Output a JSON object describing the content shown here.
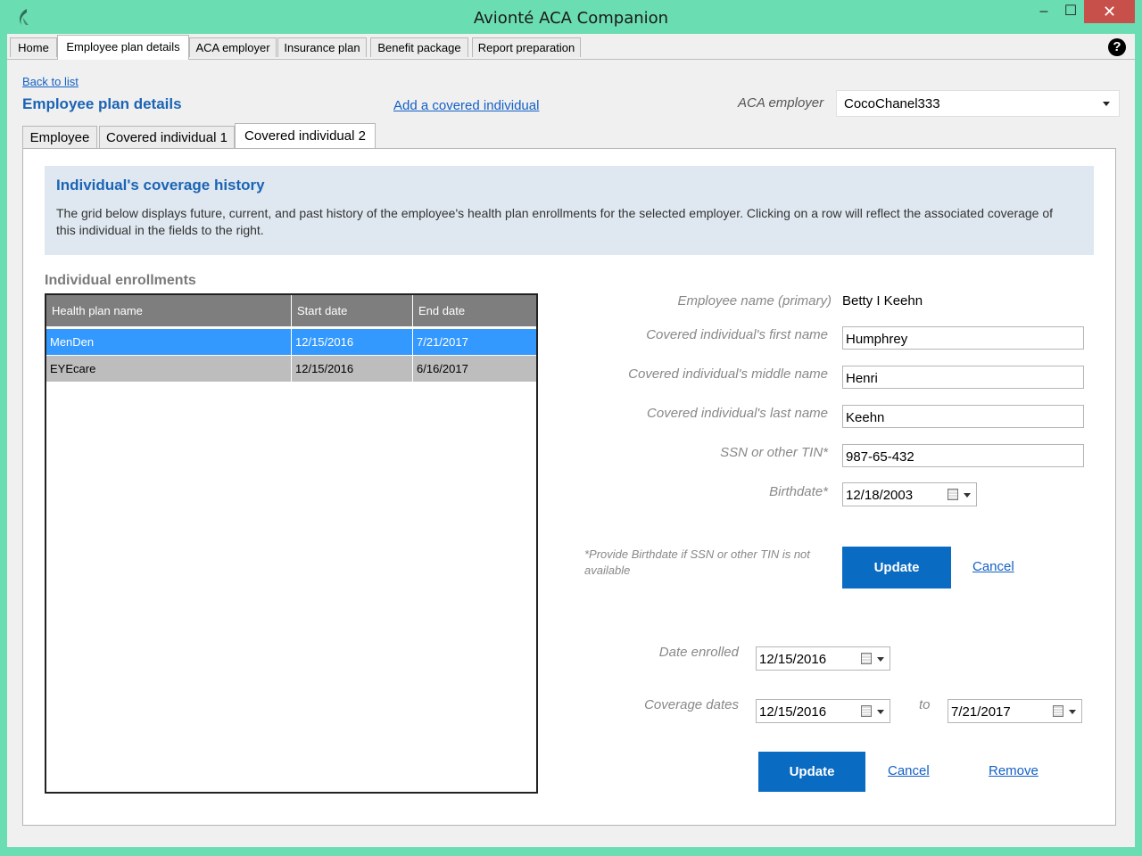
{
  "window": {
    "title": "Avionté ACA Companion",
    "minimize": "–",
    "maximize": "☐",
    "close": "✕"
  },
  "main_tabs": [
    {
      "label": "Home"
    },
    {
      "label": "Employee plan details"
    },
    {
      "label": "ACA employer"
    },
    {
      "label": "Insurance plan"
    },
    {
      "label": "Benefit package"
    },
    {
      "label": "Report preparation"
    }
  ],
  "help": "?",
  "header": {
    "back_link": "Back to list",
    "page_title": "Employee plan details",
    "add_link": "Add a covered individual",
    "employer_label": "ACA employer",
    "employer_value": "CocoChanel333"
  },
  "sub_tabs": [
    {
      "label": "Employee"
    },
    {
      "label": "Covered individual 1"
    },
    {
      "label": "Covered individual 2"
    }
  ],
  "info": {
    "title": "Individual's coverage history",
    "text": "The grid below displays future, current, and past history of the employee's health plan enrollments for the selected employer. Clicking on a row will reflect the associated coverage of this individual in the fields to the right."
  },
  "enrollments": {
    "title": "Individual enrollments",
    "columns": [
      "Health plan name",
      "Start date",
      "End date"
    ],
    "rows": [
      [
        "MenDen",
        "12/15/2016",
        "7/21/2017"
      ],
      [
        "EYEcare",
        "12/15/2016",
        "6/16/2017"
      ]
    ]
  },
  "form": {
    "employee_name_label": "Employee name (primary)",
    "employee_name_value": "Betty I Keehn",
    "first_name_label": "Covered individual's first name",
    "first_name_value": "Humphrey",
    "middle_name_label": "Covered individual's middle name",
    "middle_name_value": "Henri",
    "last_name_label": "Covered individual's last name",
    "last_name_value": "Keehn",
    "ssn_label": "SSN or other TIN*",
    "ssn_value": "987-65-432",
    "birthdate_label": "Birthdate*",
    "birthdate_value": "12/18/2003",
    "note": "*Provide Birthdate if SSN or other TIN is not available",
    "update_label": "Update",
    "cancel_label": "Cancel"
  },
  "coverage": {
    "date_enrolled_label": "Date enrolled",
    "date_enrolled_value": "12/15/2016",
    "coverage_dates_label": "Coverage dates",
    "coverage_from_value": "12/15/2016",
    "to_label": "to",
    "coverage_to_value": "7/21/2017",
    "update_label": "Update",
    "cancel_label": "Cancel",
    "remove_label": "Remove"
  }
}
